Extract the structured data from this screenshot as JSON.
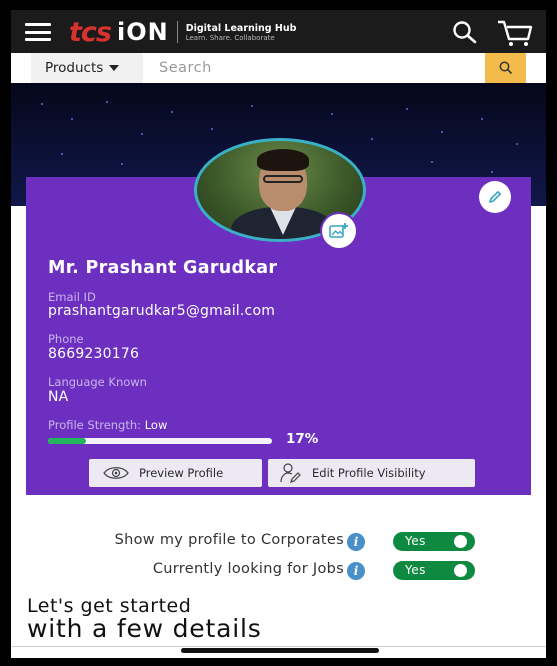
{
  "header": {
    "brand_tcs": "tcs",
    "brand_ion": "iON",
    "brand_title": "Digital Learning Hub",
    "brand_tagline": "Learn. Share. Collaborate"
  },
  "search": {
    "category_label": "Products",
    "placeholder": "Search"
  },
  "profile": {
    "name": "Mr. Prashant Garudkar",
    "email_label": "Email ID",
    "email": "prashantgarudkar5@gmail.com",
    "phone_label": "Phone",
    "phone": "8669230176",
    "language_label": "Language Known",
    "language": "NA",
    "strength_label": "Profile Strength:",
    "strength_value": "Low",
    "strength_percent_text": "17%",
    "strength_fraction": 0.17,
    "preview_button": "Preview Profile",
    "visibility_button": "Edit Profile Visibility"
  },
  "settings": {
    "corporates_label": "Show my profile to Corporates",
    "corporates_value": "Yes",
    "jobs_label": "Currently looking for Jobs",
    "jobs_value": "Yes"
  },
  "onboarding": {
    "line1": "Let's get started",
    "line2": "with a few details"
  },
  "colors": {
    "card": "#6c2fc0",
    "progress": "#22b45a",
    "toggle_on": "#0e8a40",
    "search_button": "#f2bb4c",
    "brand_red": "#d8322f"
  }
}
